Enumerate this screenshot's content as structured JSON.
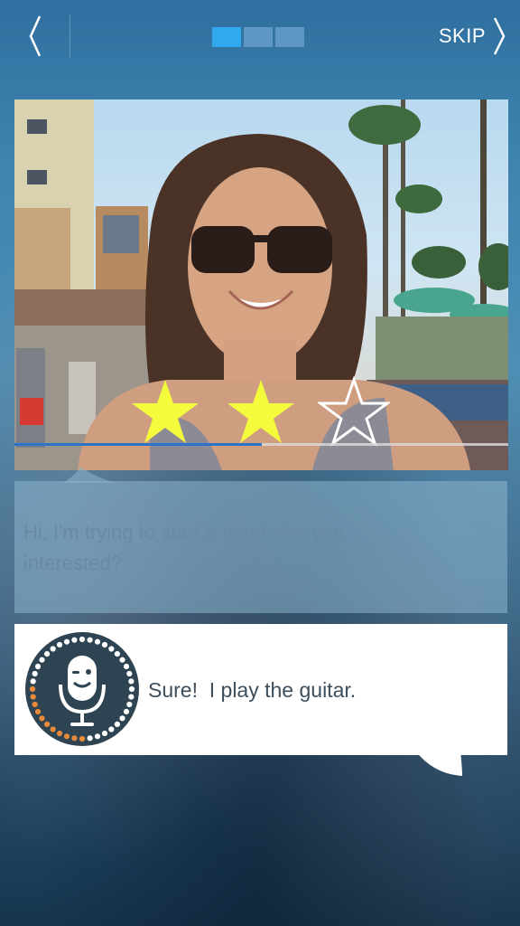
{
  "header": {
    "back_icon": "chevron-left-icon",
    "progress_total": 3,
    "progress_current": 1,
    "skip_label": "SKIP",
    "skip_icon": "chevron-right-icon"
  },
  "video": {
    "rating": {
      "earned": 2,
      "total": 3,
      "filled_color": "#f4fb3c"
    },
    "playback_progress": 0.5
  },
  "prompt": {
    "text": "Hi, I'm trying to start a band. Are you interested?"
  },
  "response": {
    "mic_icon": "winking-microphone-icon",
    "text": "Sure!  I play the guitar."
  },
  "colors": {
    "accent": "#31a9ee",
    "timeline": "#2d73c8"
  }
}
